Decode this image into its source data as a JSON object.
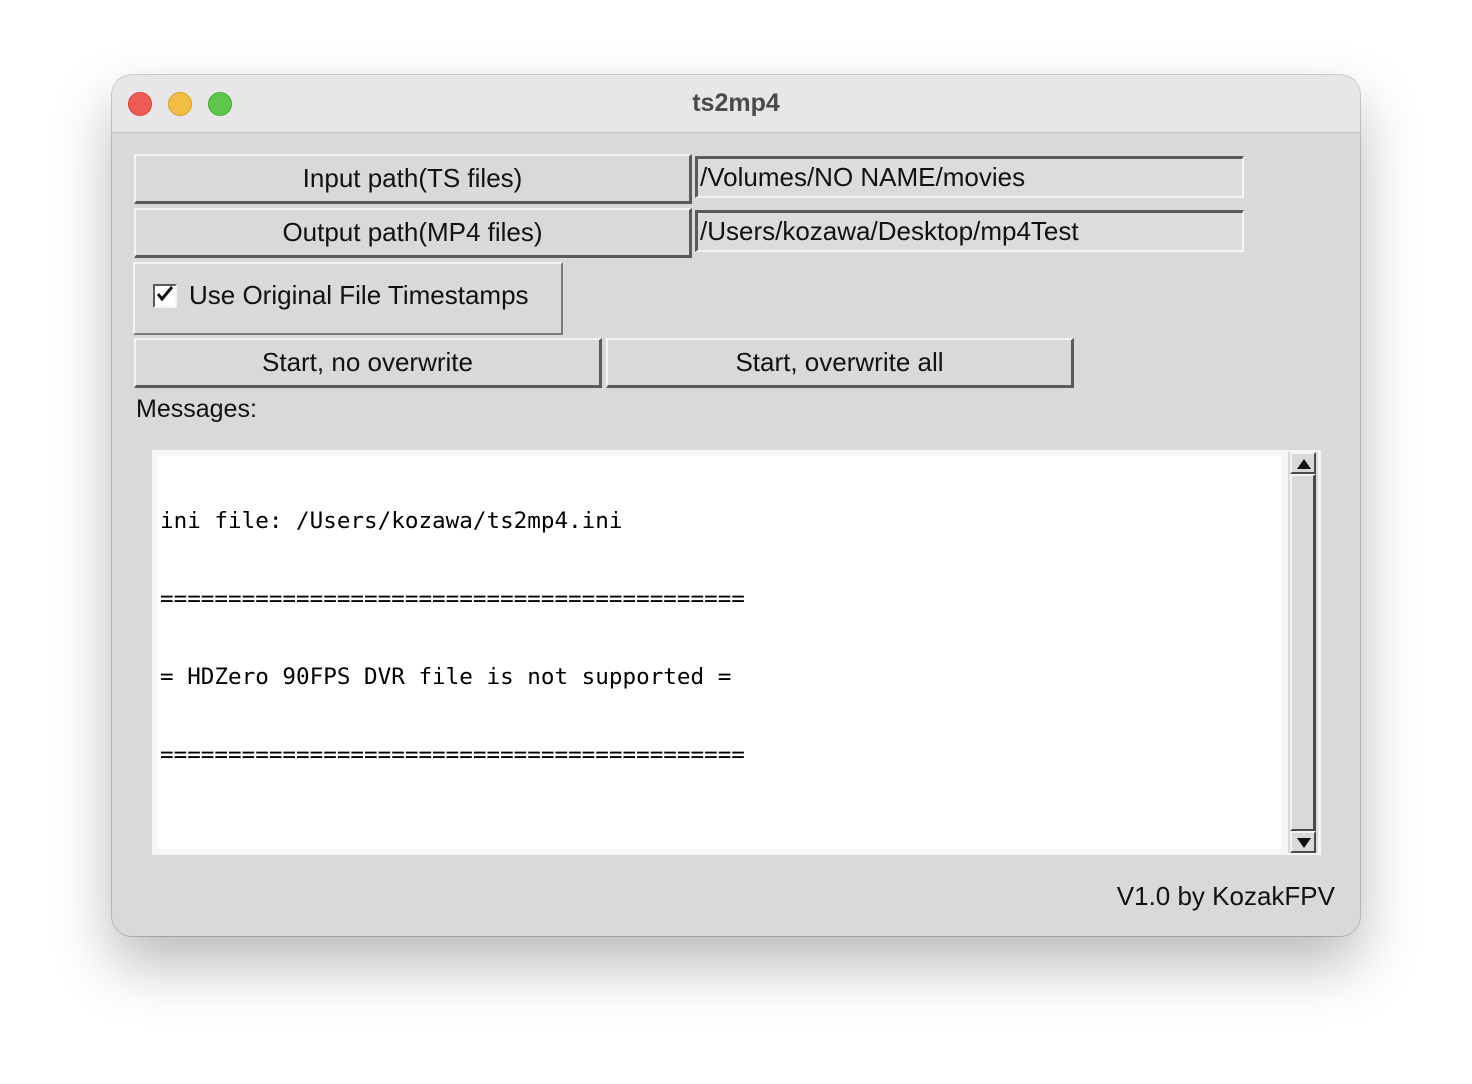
{
  "window": {
    "title": "ts2mp4"
  },
  "paths": {
    "input_button_label": "Input path(TS files)",
    "input_value": "/Volumes/NO NAME/movies",
    "output_button_label": "Output path(MP4 files)",
    "output_value": "/Users/kozawa/Desktop/mp4Test"
  },
  "options": {
    "timestamps_label": "Use Original File Timestamps",
    "timestamps_checked": true
  },
  "actions": {
    "start_no_overwrite_label": "Start, no overwrite",
    "start_overwrite_all_label": "Start, overwrite all"
  },
  "messages": {
    "label": "Messages:",
    "lines": [
      "ini file: /Users/kozawa/ts2mp4.ini",
      "===========================================",
      "= HDZero 90FPS DVR file is not supported =",
      "==========================================="
    ]
  },
  "footer": {
    "version_text": "V1.0 by KozakFPV"
  },
  "icons": {
    "close": "close-traffic-light",
    "minimize": "minimize-traffic-light",
    "zoom": "zoom-traffic-light",
    "scroll_up": "arrow-up-icon",
    "scroll_down": "arrow-down-icon",
    "check": "checkmark-icon"
  },
  "colors": {
    "window_bg": "#d9d9d9",
    "close": "#ee5b55",
    "minimize": "#f4bd46",
    "zoom": "#5ec54d"
  }
}
